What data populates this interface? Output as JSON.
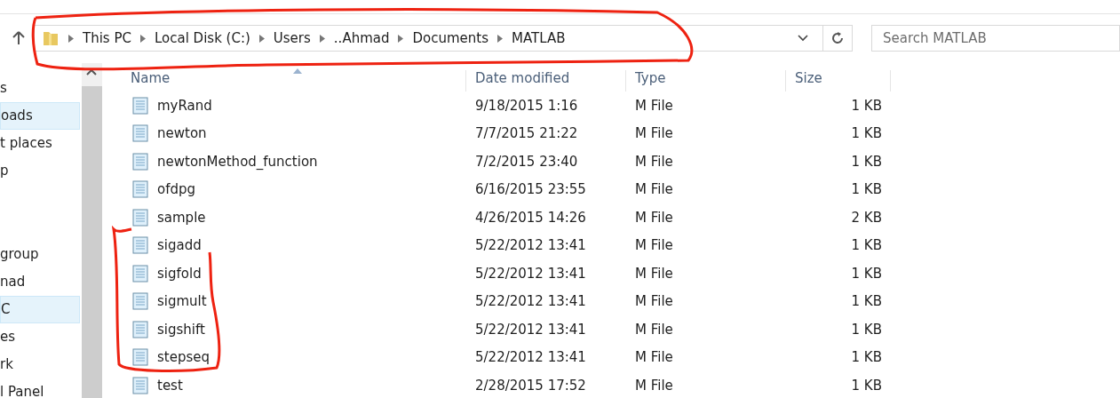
{
  "address_bar": {
    "breadcrumbs": [
      "This PC",
      "Local Disk (C:)",
      "Users",
      "..Ahmad",
      "Documents",
      "MATLAB"
    ]
  },
  "search": {
    "placeholder": "Search MATLAB"
  },
  "sidebar": {
    "groups": [
      [
        {
          "label": "s",
          "selected": false
        },
        {
          "label": "oads",
          "selected": true
        },
        {
          "label": "t places",
          "selected": false
        },
        {
          "label": "p",
          "selected": false
        }
      ],
      [
        {
          "label": "group",
          "selected": false
        },
        {
          "label": "nad",
          "selected": false
        },
        {
          "label": "C",
          "selected": true
        },
        {
          "label": "es",
          "selected": false
        },
        {
          "label": "rk",
          "selected": false
        },
        {
          "label": "l Panel",
          "selected": false
        }
      ]
    ]
  },
  "table": {
    "columns": [
      "Name",
      "Date modified",
      "Type",
      "Size"
    ],
    "rows": [
      [
        "myRand",
        "9/18/2015 1:16",
        "M File",
        "1 KB"
      ],
      [
        "newton",
        "7/7/2015 21:22",
        "M File",
        "1 KB"
      ],
      [
        "newtonMethod_function",
        "7/2/2015 23:40",
        "M File",
        "1 KB"
      ],
      [
        "ofdpg",
        "6/16/2015 23:55",
        "M File",
        "1 KB"
      ],
      [
        "sample",
        "4/26/2015 14:26",
        "M File",
        "2 KB"
      ],
      [
        "sigadd",
        "5/22/2012 13:41",
        "M File",
        "1 KB"
      ],
      [
        "sigfold",
        "5/22/2012 13:41",
        "M File",
        "1 KB"
      ],
      [
        "sigmult",
        "5/22/2012 13:41",
        "M File",
        "1 KB"
      ],
      [
        "sigshift",
        "5/22/2012 13:41",
        "M File",
        "1 KB"
      ],
      [
        "stepseq",
        "5/22/2012 13:41",
        "M File",
        "1 KB"
      ],
      [
        "test",
        "2/28/2015 17:52",
        "M File",
        "1 KB"
      ]
    ]
  }
}
